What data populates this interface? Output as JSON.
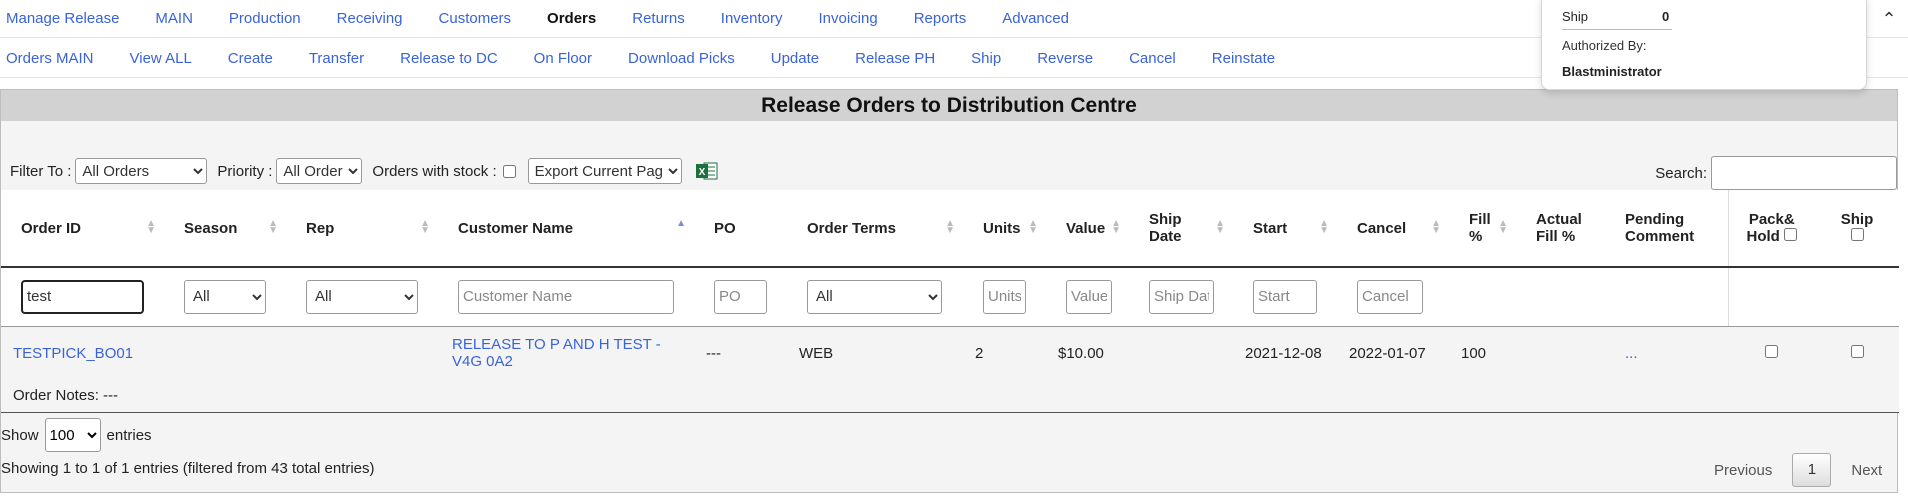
{
  "top_nav": [
    "Manage Release",
    "MAIN",
    "Production",
    "Receiving",
    "Customers",
    "Orders",
    "Returns",
    "Inventory",
    "Invoicing",
    "Reports",
    "Advanced"
  ],
  "top_nav_active": "Orders",
  "sub_nav": [
    "Orders MAIN",
    "View ALL",
    "Create",
    "Transfer",
    "Release to DC",
    "On Floor",
    "Download Picks",
    "Update",
    "Release PH",
    "Ship",
    "Reverse",
    "Cancel",
    "Reinstate"
  ],
  "popover": {
    "ship_label": "Ship",
    "ship_value": "0",
    "authorized_label": "Authorized By:",
    "authorized_value": "Blastministrator"
  },
  "panel_title": "Release Orders to Distribution Centre",
  "filters": {
    "filter_to_label": "Filter To :",
    "filter_to_value": "All Orders",
    "priority_label": "Priority :",
    "priority_value": "All Orders",
    "with_stock_label": "Orders with stock :",
    "export_value": "Export Current Page"
  },
  "search_label": "Search:",
  "columns": {
    "order_id": "Order ID",
    "season": "Season",
    "rep": "Rep",
    "customer_name": "Customer Name",
    "po": "PO",
    "order_terms": "Order Terms",
    "units": "Units",
    "value": "Value",
    "ship_date_1": "Ship",
    "ship_date_2": "Date",
    "start": "Start",
    "cancel": "Cancel",
    "fill_1": "Fill",
    "fill_2": "%",
    "actual_fill_1": "Actual",
    "actual_fill_2": "Fill %",
    "pending_1": "Pending",
    "pending_2": "Comment",
    "pack_hold_1": "Pack&",
    "pack_hold_2": "Hold",
    "ship": "Ship"
  },
  "column_filters": {
    "order_id_value": "test",
    "season_value": "All",
    "rep_value": "All",
    "customer_name_placeholder": "Customer Name",
    "po_placeholder": "PO",
    "order_terms_value": "All",
    "units_placeholder": "Units",
    "value_placeholder": "Value",
    "ship_date_placeholder": "Ship Date",
    "start_placeholder": "Start",
    "cancel_placeholder": "Cancel"
  },
  "rows": [
    {
      "order_id": "TESTPICK_BO01",
      "season": "",
      "rep": "",
      "customer_name": "RELEASE TO P AND H TEST - V4G 0A2",
      "po": "---",
      "order_terms": "WEB",
      "units": "2",
      "value": "$10.00",
      "ship_date": "",
      "start": "2021-12-08",
      "cancel": "2022-01-07",
      "fill": "100",
      "actual_fill": "",
      "pending_comment": "...",
      "notes": "Order Notes: ---"
    }
  ],
  "show_label_1": "Show",
  "show_value": "100",
  "show_label_2": "entries",
  "info": "Showing 1 to 1 of 1 entries (filtered from 43 total entries)",
  "pager": {
    "previous": "Previous",
    "page": "1",
    "next": "Next"
  }
}
